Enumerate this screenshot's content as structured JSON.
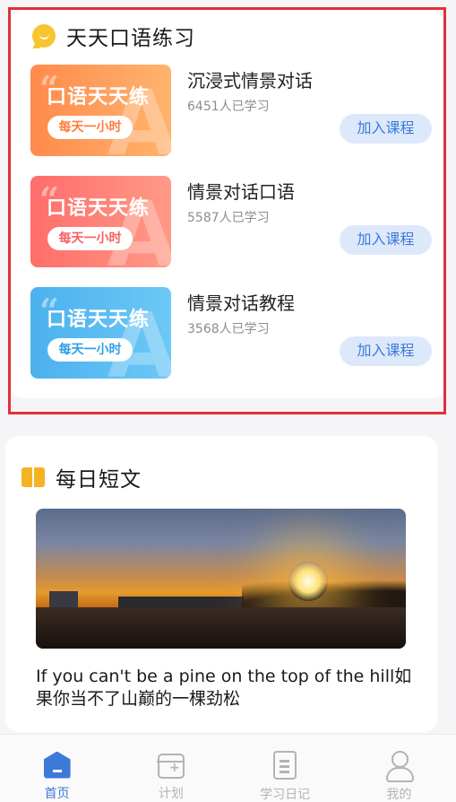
{
  "practice": {
    "title": "天天口语练习",
    "courses": [
      {
        "thumb_title": "口语天天练",
        "thumb_badge": "每天一小时",
        "name": "沉浸式情景对话",
        "count": "6451人已学习",
        "button": "加入课程"
      },
      {
        "thumb_title": "口语天天练",
        "thumb_badge": "每天一小时",
        "name": "情景对话口语",
        "count": "5587人已学习",
        "button": "加入课程"
      },
      {
        "thumb_title": "口语天天练",
        "thumb_badge": "每天一小时",
        "name": "情景对话教程",
        "count": "3568人已学习",
        "button": "加入课程"
      }
    ]
  },
  "daily": {
    "title": "每日短文",
    "quote": "If you can't be a pine on the top of the hill如果你当不了山巅的一棵劲松"
  },
  "nav": {
    "items": [
      {
        "label": "首页",
        "icon": "home-icon",
        "active": true
      },
      {
        "label": "计划",
        "icon": "calendar-icon",
        "active": false
      },
      {
        "label": "学习日记",
        "icon": "diary-icon",
        "active": false
      },
      {
        "label": "我的",
        "icon": "user-icon",
        "active": false
      }
    ]
  },
  "colors": {
    "accent": "#3d7ad8",
    "highlight_border": "#e0313a",
    "thumb_orange": "#ff8a4c",
    "thumb_red": "#ff6d6a",
    "thumb_blue": "#4cb1ee"
  }
}
